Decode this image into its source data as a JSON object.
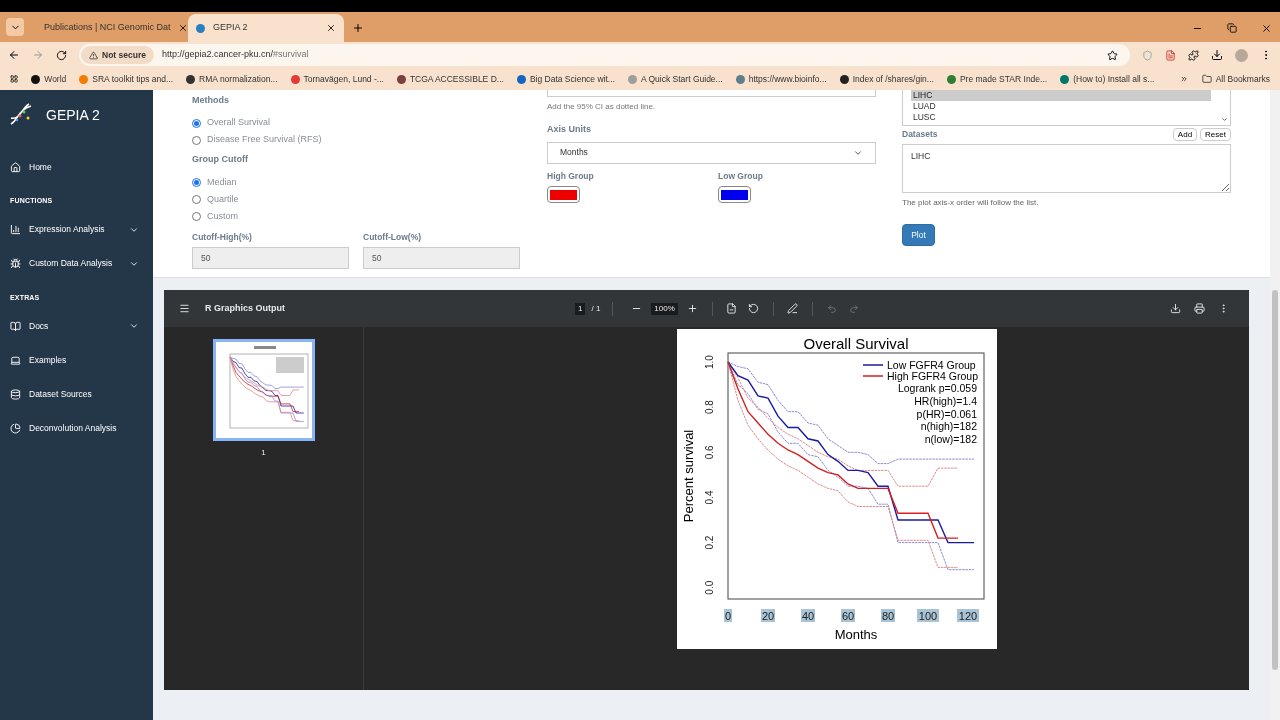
{
  "browser": {
    "tabs": [
      {
        "title": "Publications | NCI Genomic Dat",
        "selected": false
      },
      {
        "title": "GEPIA 2",
        "selected": true
      }
    ],
    "security": "Not secure",
    "url_host": "http://gepia2.cancer-pku.cn/",
    "url_path": "#survival",
    "bookmarks": [
      {
        "title": "World",
        "color": "#111111"
      },
      {
        "title": "SRA toolkit tips and...",
        "color": "#f57c00"
      },
      {
        "title": "RMA normalization...",
        "color": "#333333"
      },
      {
        "title": "Tornavägen, Lund -...",
        "color": "#e53935"
      },
      {
        "title": "TCGA ACCESSIBLE D...",
        "color": "#7b3f3f"
      },
      {
        "title": "Big Data Science wit...",
        "color": "#1565c0"
      },
      {
        "title": "A Quick Start Guide...",
        "color": "#9e9e9e"
      },
      {
        "title": "https://www.bioinfo...",
        "color": "#607d8b"
      },
      {
        "title": "Index of /shares/gin...",
        "color": "#212121"
      },
      {
        "title": "Pre made STAR Inde...",
        "color": "#2e7d32"
      },
      {
        "title": "(How to) Install all s...",
        "color": "#00796b"
      }
    ],
    "all_bookmarks": "All Bookmarks"
  },
  "sidebar": {
    "brand": "GEPIA 2",
    "items": [
      {
        "kind": "link",
        "label": "Home",
        "expandable": false
      },
      {
        "kind": "header",
        "label": "FUNCTIONS"
      },
      {
        "kind": "link",
        "label": "Expression Analysis",
        "expandable": true
      },
      {
        "kind": "link",
        "label": "Custom Data Analysis",
        "expandable": true
      },
      {
        "kind": "header",
        "label": "EXTRAS"
      },
      {
        "kind": "link",
        "label": "Docs",
        "expandable": true
      },
      {
        "kind": "link",
        "label": "Examples",
        "expandable": false
      },
      {
        "kind": "link",
        "label": "Dataset Sources",
        "expandable": false
      },
      {
        "kind": "link",
        "label": "Deconvolution Analysis",
        "expandable": false
      }
    ]
  },
  "form": {
    "methods_label": "Methods",
    "methods": [
      {
        "label": "Overall Survival",
        "selected": true
      },
      {
        "label": "Disease Free Survival (RFS)",
        "selected": false
      }
    ],
    "cutoff_label": "Group Cutoff",
    "cutoffs": [
      {
        "label": "Median",
        "selected": true
      },
      {
        "label": "Quartile",
        "selected": false
      },
      {
        "label": "Custom",
        "selected": false
      }
    ],
    "cutoff_high_label": "Cutoff-High(%)",
    "cutoff_high": "50",
    "cutoff_low_label": "Cutoff-Low(%)",
    "cutoff_low": "50",
    "ci_hint": "Add the 95% CI as dotted line.",
    "axis_units_label": "Axis Units",
    "axis_units": "Months",
    "high_group_label": "High Group",
    "low_group_label": "Low Group",
    "dataset_options": [
      {
        "label": "LIHC",
        "selected": true
      },
      {
        "label": "LUAD",
        "selected": false
      },
      {
        "label": "LUSC",
        "selected": false
      }
    ],
    "datasets_label": "Datasets",
    "add": "Add",
    "reset": "Reset",
    "datasets_value": "LIHC",
    "order_hint": "The plot axis-x order will follow the list.",
    "plot": "Plot"
  },
  "viewer": {
    "title": "R Graphics Output",
    "page": "1",
    "page_total": "/ 1",
    "zoom": "100%",
    "undo_disabled": true,
    "redo_disabled": true,
    "thumbnail_label": "1",
    "plot": {
      "tick_labels_selected": true,
      "stats": [
        "Logrank p=0.059",
        "HR(high)=1.4",
        "p(HR)=0.061",
        "n(high)=182",
        "n(low)=182"
      ],
      "chart_data": {
        "type": "line",
        "title": "Overall Survival",
        "xlabel": "Months",
        "ylabel": "Percent survival",
        "x": [
          0,
          5,
          10,
          15,
          20,
          25,
          30,
          35,
          40,
          45,
          50,
          55,
          60,
          65,
          70,
          75,
          80,
          85,
          90,
          95,
          100,
          105,
          110,
          115,
          120,
          123
        ],
        "series": [
          {
            "name": "Low FGFR4 Group",
            "color": "#1a1aa6",
            "values": [
              1.0,
              0.94,
              0.92,
              0.85,
              0.84,
              0.76,
              0.71,
              0.71,
              0.66,
              0.65,
              0.59,
              0.56,
              0.52,
              0.52,
              0.51,
              0.45,
              0.45,
              0.3,
              0.3,
              0.3,
              0.3,
              0.3,
              0.2,
              0.2,
              0.2,
              0.2
            ]
          },
          {
            "name": "High FGFR4 Group",
            "color": "#d32020",
            "values": [
              1.0,
              0.88,
              0.78,
              0.73,
              0.68,
              0.64,
              0.61,
              0.59,
              0.56,
              0.53,
              0.51,
              0.5,
              0.46,
              0.44,
              0.44,
              0.44,
              0.44,
              0.33,
              0.33,
              0.33,
              0.33,
              0.22,
              0.22,
              0.22,
              null,
              null
            ]
          },
          {
            "color": "#8a8ad6",
            "line_style": "dotted",
            "values": [
              1.0,
              0.98,
              0.97,
              0.91,
              0.9,
              0.83,
              0.78,
              0.78,
              0.73,
              0.72,
              0.66,
              0.63,
              0.6,
              0.6,
              0.59,
              0.55,
              0.55,
              0.57,
              0.57,
              0.57,
              0.57,
              0.57,
              0.57,
              0.57,
              0.57,
              0.57
            ]
          },
          {
            "color": "#8a8ad6",
            "line_style": "dotted",
            "values": [
              1.0,
              0.9,
              0.86,
              0.79,
              0.77,
              0.69,
              0.64,
              0.64,
              0.59,
              0.58,
              0.52,
              0.49,
              0.45,
              0.45,
              0.44,
              0.37,
              0.37,
              0.2,
              0.2,
              0.2,
              0.2,
              0.2,
              0.08,
              0.08,
              0.08,
              0.08
            ]
          },
          {
            "color": "#e08a8a",
            "line_style": "dotted",
            "values": [
              1.0,
              0.93,
              0.84,
              0.8,
              0.75,
              0.71,
              0.68,
              0.66,
              0.63,
              0.6,
              0.58,
              0.57,
              0.54,
              0.52,
              0.52,
              0.52,
              0.52,
              0.45,
              0.45,
              0.45,
              0.45,
              0.53,
              0.53,
              0.53,
              null,
              null
            ]
          },
          {
            "color": "#e08a8a",
            "line_style": "dotted",
            "values": [
              1.0,
              0.83,
              0.72,
              0.66,
              0.61,
              0.57,
              0.54,
              0.52,
              0.49,
              0.46,
              0.44,
              0.43,
              0.38,
              0.36,
              0.36,
              0.36,
              0.36,
              0.21,
              0.21,
              0.21,
              0.21,
              0.09,
              0.09,
              0.09,
              null,
              null
            ]
          }
        ],
        "legend": "topright",
        "xlim": [
          0,
          128
        ],
        "ylim": [
          -0.05,
          1.04
        ],
        "xticks": [
          0,
          20,
          40,
          60,
          80,
          100,
          120
        ],
        "yticks": [
          {
            "value": 0,
            "label": "0.0"
          },
          {
            "value": 0.2,
            "label": "0.2"
          },
          {
            "value": 0.4,
            "label": "0.4"
          },
          {
            "value": 0.6,
            "label": "0.6"
          },
          {
            "value": 0.8,
            "label": "0.8"
          },
          {
            "value": 1,
            "label": "1.0"
          }
        ]
      }
    }
  }
}
